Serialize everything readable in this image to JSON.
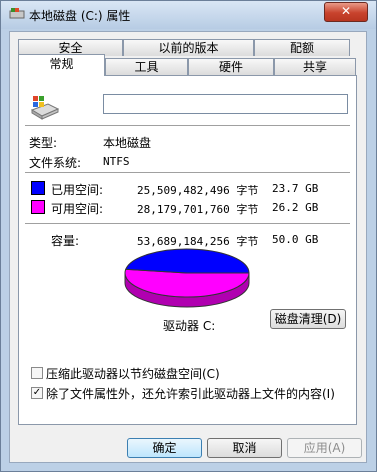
{
  "window": {
    "title": "本地磁盘 (C:) 属性",
    "close_label": "✕"
  },
  "tabs": {
    "security": "安全",
    "previous_versions": "以前的版本",
    "quota": "配额",
    "general": "常规",
    "tools": "工具",
    "hardware": "硬件",
    "sharing": "共享"
  },
  "general": {
    "volume_label_value": "",
    "type_label": "类型:",
    "type_value": "本地磁盘",
    "fs_label": "文件系统:",
    "fs_value": "NTFS",
    "used": {
      "label": "已用空间:",
      "bytes": "25,509,482,496 字节",
      "size": "23.7 GB",
      "color": "#0000ff"
    },
    "free": {
      "label": "可用空间:",
      "bytes": "28,179,701,760 字节",
      "size": "26.2 GB",
      "color": "#ff00ff"
    },
    "capacity": {
      "label": "容量:",
      "bytes": "53,689,184,256 字节",
      "size": "50.0 GB"
    },
    "drive_label": "驱动器 C:",
    "cleanup_button": "磁盘清理(D)",
    "used_fraction": 0.475,
    "compress_label": "压缩此驱动器以节约磁盘空间(C)",
    "compress_checked": false,
    "index_label": "除了文件属性外，还允许索引此驱动器上文件的内容(I)",
    "index_checked": true
  },
  "footer": {
    "ok": "确定",
    "cancel": "取消",
    "apply": "应用(A)"
  },
  "icons": [
    "drive-icon",
    "drive-large-icon",
    "close-icon",
    "checkmark-icon"
  ]
}
